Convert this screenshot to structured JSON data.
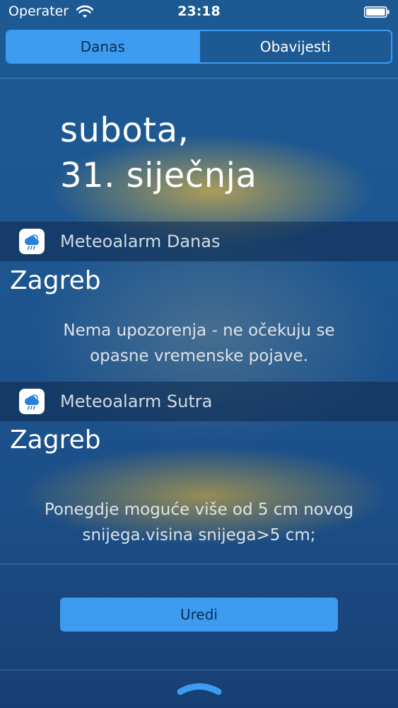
{
  "status_bar": {
    "carrier": "Operater",
    "time": "23:18",
    "wifi_icon": "wifi-icon",
    "battery_icon": "battery-icon"
  },
  "tabs": [
    {
      "label": "Danas",
      "selected": true
    },
    {
      "label": "Obavijesti",
      "selected": false
    }
  ],
  "date": {
    "line1": "subota,",
    "line2": "31. siječnja"
  },
  "widgets": [
    {
      "title": "Meteoalarm Danas",
      "icon": "weather-cloud-icon",
      "city": "Zagreb",
      "message_line1": "Nema upozorenja - ne očekuju se",
      "message_line2": "opasne vremenske pojave."
    },
    {
      "title": "Meteoalarm Sutra",
      "icon": "weather-cloud-icon",
      "city": "Zagreb",
      "message_line1": "Ponegdje moguće više od 5 cm novog",
      "message_line2": "snijega.visina snijega>5 cm;"
    }
  ],
  "edit_button": {
    "label": "Uredi"
  },
  "colors": {
    "accent": "#3d9cf0",
    "accent_text": "#0b2d55"
  }
}
